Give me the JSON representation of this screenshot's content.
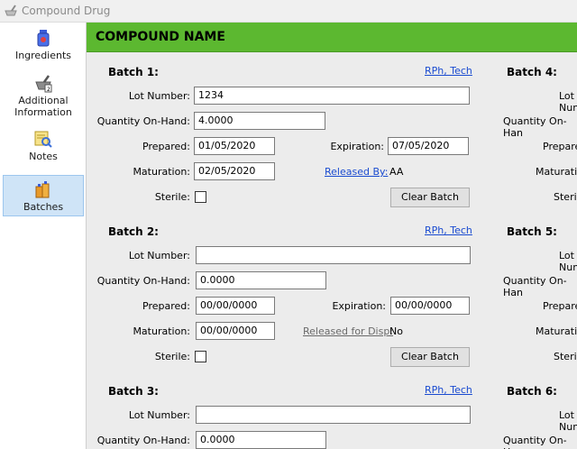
{
  "window": {
    "title": "Compound Drug"
  },
  "sidebar": {
    "items": [
      {
        "label": "Ingredients"
      },
      {
        "label": "Additional Information"
      },
      {
        "label": "Notes"
      },
      {
        "label": "Batches"
      }
    ]
  },
  "header": {
    "name": "COMPOUND NAME"
  },
  "labels": {
    "lot_number": "Lot Number:",
    "quantity": "Quantity On-Hand:",
    "prepared": "Prepared:",
    "maturation": "Maturation:",
    "expiration": "Expiration:",
    "sterile": "Sterile:",
    "clear_batch": "Clear Batch",
    "rph_tech": "RPh, Tech"
  },
  "batches": [
    {
      "title": "Batch 1:",
      "lot": "1234",
      "quantity": "4.0000",
      "prepared": "01/05/2020",
      "expiration": "07/05/2020",
      "maturation": "02/05/2020",
      "release_label": "Released By:",
      "release_value": "AA"
    },
    {
      "title": "Batch 2:",
      "lot": "",
      "quantity": "0.0000",
      "prepared": "00/00/0000",
      "expiration": "00/00/0000",
      "maturation": "00/00/0000",
      "release_label": "Released for Disp:",
      "release_value": "No"
    },
    {
      "title": "Batch 3:",
      "lot": "",
      "quantity": "0.0000"
    }
  ],
  "right_column": {
    "batch4": {
      "title": "Batch 4:",
      "lot": "Lot Numbe",
      "quantity": "Quantity On-Han",
      "prepared": "Prepare",
      "maturation": "Maturatio",
      "sterile": "Sterile"
    },
    "batch5": {
      "title": "Batch 5:",
      "lot": "Lot Numbe",
      "quantity": "Quantity On-Han",
      "prepared": "Prepare",
      "maturation": "Maturatio",
      "sterile": "Sterile"
    },
    "batch6": {
      "title": "Batch 6:",
      "lot": "Lot Numbe",
      "quantity": "Quantity On-Han"
    }
  }
}
